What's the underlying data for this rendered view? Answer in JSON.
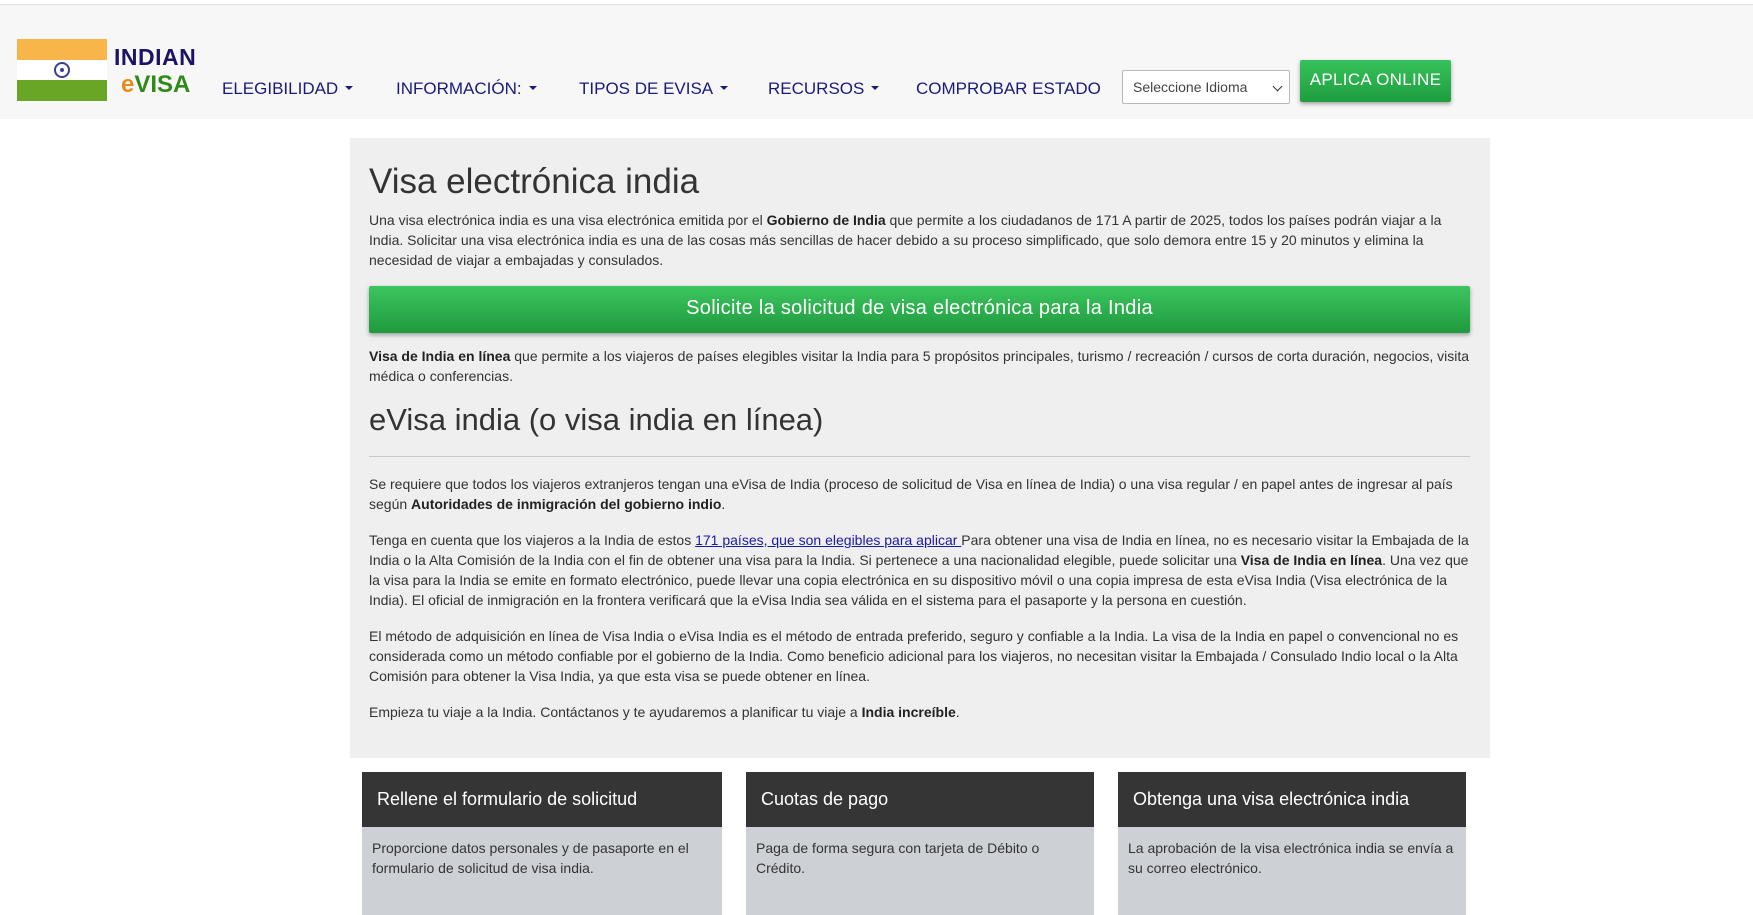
{
  "logo": {
    "line1": "INDIAN",
    "line2_prefix": "e",
    "line2_rest": "VISA"
  },
  "nav": {
    "items": [
      {
        "label": "ELEGIBILIDAD",
        "has_caret": true
      },
      {
        "label": "INFORMACIÓN:",
        "has_caret": true
      },
      {
        "label": "TIPOS DE EVISA",
        "has_caret": true
      },
      {
        "label": "RECURSOS",
        "has_caret": true
      },
      {
        "label": "COMPROBAR ESTADO",
        "has_caret": false
      }
    ]
  },
  "language_select": {
    "selected": "Seleccione Idioma"
  },
  "apply_online_label": "APLICA ONLINE",
  "main": {
    "title": "Visa electrónica india",
    "intro": {
      "pre": "Una visa electrónica india es una visa electrónica emitida por el ",
      "bold": "Gobierno de India",
      "post": " que permite a los ciudadanos de 171 A partir de 2025, todos los países podrán viajar a la India. Solicitar una visa electrónica india es una de las cosas más sencillas de hacer debido a su proceso simplificado, que solo demora entre 15 y 20 minutos y elimina la necesidad de viajar a embajadas y consulados."
    },
    "apply_button_label": "Solicite la solicitud de visa electrónica para la India",
    "purpose": {
      "bold": "Visa de India en línea",
      "post": " que permite a los viajeros de países elegibles visitar la India para 5 propósitos principales, turismo / recreación / cursos de corta duración, negocios, visita médica o conferencias."
    },
    "subtitle": "eVisa india (o visa india en línea)",
    "para1": {
      "pre": "Se requiere que todos los viajeros extranjeros tengan una eVisa de India (proceso de solicitud de Visa en línea de India) o una visa regular / en papel antes de ingresar al país según ",
      "bold": "Autoridades de inmigración del gobierno indio",
      "post": "."
    },
    "para2": {
      "pre": "Tenga en cuenta que los viajeros a la India de estos ",
      "link": "171 países, que son elegibles para aplicar ",
      "mid": "Para obtener una visa de India en línea, no es necesario visitar la Embajada de la India o la Alta Comisión de la India con el fin de obtener una visa para la India. Si pertenece a una nacionalidad elegible, puede solicitar una ",
      "bold": "Visa de India en línea",
      "post": ". Una vez que la visa para la India se emite en formato electrónico, puede llevar una copia electrónica en su dispositivo móvil o una copia impresa de esta eVisa India (Visa electrónica de la India). El oficial de inmigración en la frontera verificará que la eVisa India sea válida en el sistema para el pasaporte y la persona en cuestión."
    },
    "para3": "El método de adquisición en línea de Visa India o eVisa India es el método de entrada preferido, seguro y confiable a la India. La visa de la India en papel o convencional no es considerada como un método confiable por el gobierno de la India. Como beneficio adicional para los viajeros, no necesitan visitar la Embajada / Consulado Indio local o la Alta Comisión para obtener la Visa India, ya que esta visa se puede obtener en línea.",
    "para4": {
      "pre": "Empieza tu viaje a la India. Contáctanos y te ayudaremos a planificar tu viaje a ",
      "bold": "India increíble",
      "post": "."
    }
  },
  "cards": [
    {
      "title": "Rellene el formulario de solicitud",
      "body": "Proporcione datos personales y de pasaporte en el formulario de solicitud de visa india."
    },
    {
      "title": "Cuotas de pago",
      "body": "Paga de forma segura con tarjeta de Débito o Crédito."
    },
    {
      "title": "Obtenga una visa electrónica india",
      "body": "La aprobación de la visa electrónica india se envía a su correo electrónico."
    }
  ]
}
